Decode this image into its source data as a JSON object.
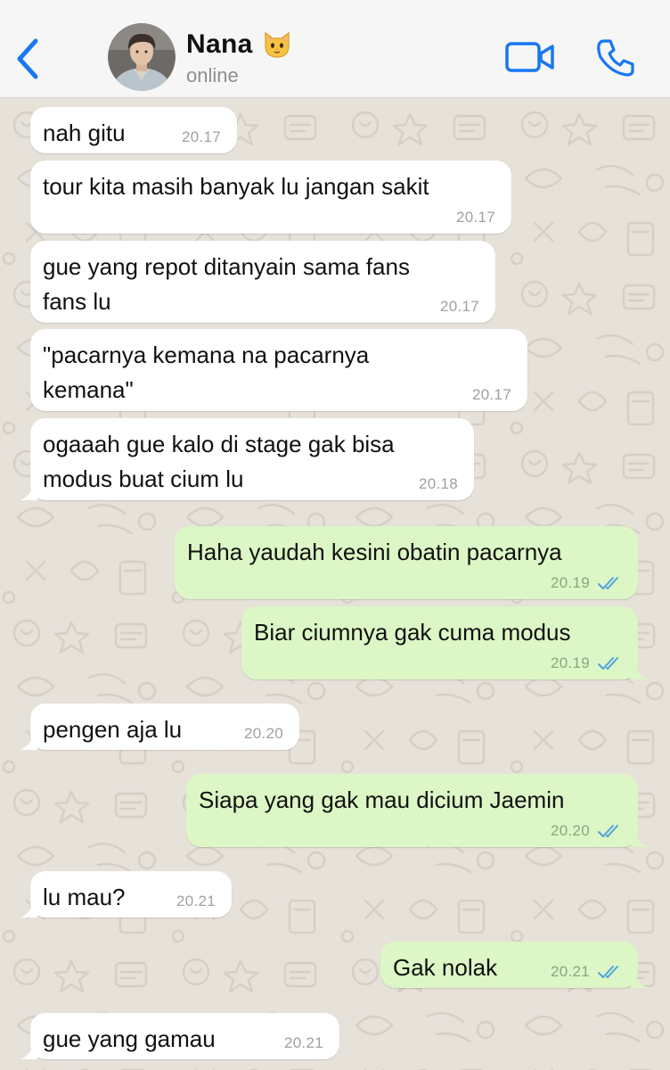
{
  "header": {
    "contact_name": "Nana",
    "contact_emoji": "🐱",
    "status": "online",
    "back_icon": "chevron-left-icon",
    "video_icon": "video-camera-icon",
    "call_icon": "phone-icon",
    "accent_color": "#1877f2"
  },
  "messages": [
    {
      "dir": "in",
      "text": "nah gitu",
      "time": "20.17"
    },
    {
      "dir": "in",
      "text": "tour kita masih banyak lu jangan sakit",
      "time": "20.17"
    },
    {
      "dir": "in",
      "text": "gue yang repot ditanyain sama fans\nfans lu",
      "time": "20.17"
    },
    {
      "dir": "in",
      "text": "\"pacarnya kemana na pacarnya\nkemana\"",
      "time": "20.17"
    },
    {
      "dir": "in",
      "text": "ogaaah gue kalo di stage gak bisa\nmodus buat cium lu",
      "time": "20.18"
    },
    {
      "dir": "out",
      "text": "Haha yaudah kesini obatin pacarnya",
      "time": "20.19",
      "read": true
    },
    {
      "dir": "out",
      "text": "Biar ciumnya gak cuma modus",
      "time": "20.19",
      "read": true
    },
    {
      "dir": "in",
      "text": "pengen aja lu",
      "time": "20.20"
    },
    {
      "dir": "out",
      "text": "Siapa yang gak mau dicium Jaemin",
      "time": "20.20",
      "read": true
    },
    {
      "dir": "in",
      "text": "lu mau?",
      "time": "20.21"
    },
    {
      "dir": "out",
      "text": "Gak nolak",
      "time": "20.21",
      "read": true
    },
    {
      "dir": "in",
      "text": "gue yang gamau",
      "time": "20.21"
    }
  ],
  "colors": {
    "incoming_bubble": "#ffffff",
    "outgoing_bubble": "#dcf7c5",
    "read_ticks": "#4fa3e0",
    "wallpaper": "#e6e1d9"
  }
}
